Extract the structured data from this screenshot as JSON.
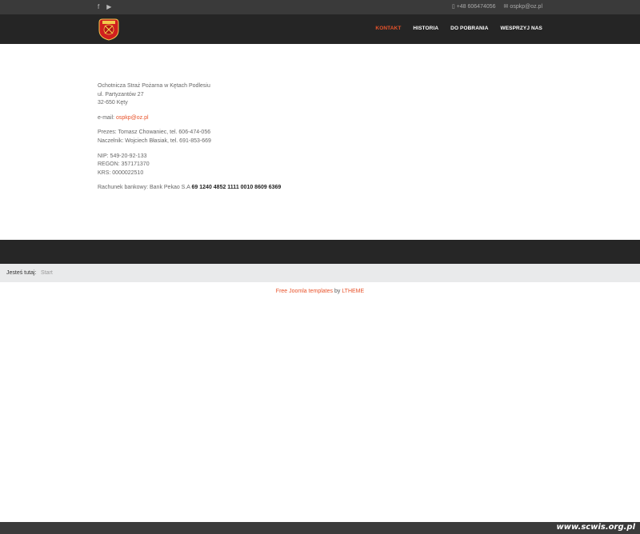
{
  "topbar": {
    "phone": "+48 606474056",
    "email": "ospkp@oz.pl",
    "social_icons": [
      "facebook-icon",
      "youtube-icon"
    ]
  },
  "nav": {
    "items": [
      "KONTAKT",
      "HISTORIA",
      "DO POBRANIA",
      "WESPRZYJ NAS"
    ],
    "active": "KONTAKT"
  },
  "content": {
    "org_name": "Ochotnicza Straż Pożarna w Kętach Podlesiu",
    "street": "ul. Partyzantów 27",
    "city": "32-650 Kęty",
    "email_label": "e-mail:",
    "email": "ospkp@oz.pl",
    "president": "Prezes: Tomasz Chowaniec, tel. 606-474-056",
    "chief": "Naczelnik: Wojciech Błasiak, tel. 691-853-669",
    "nip": "NIP: 549-20-92-133",
    "regon": "REGON: 357171370",
    "krs": "KRS: 0000022510",
    "bank_label": "Rachunek bankowy: Bank Pekao S.A",
    "bank_number": "69 1240 4852 1111 0010 8609 6369"
  },
  "breadcrumb": {
    "label": "Jesteś tutaj:",
    "current": "Start"
  },
  "credit": {
    "text1": "Free Joomla templates",
    "by": "by",
    "text2": "LTHEME"
  },
  "watermark": "www.scwis.org.pl",
  "colors": {
    "accent": "#e8532b",
    "header": "#252525",
    "topbar": "#3a3a3a"
  }
}
